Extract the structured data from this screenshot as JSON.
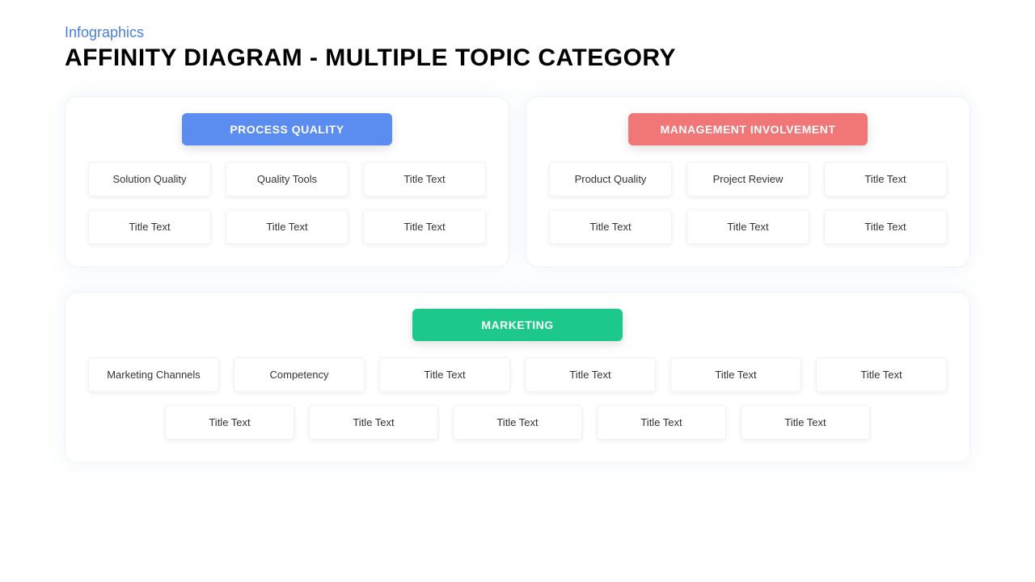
{
  "header": {
    "subtitle": "Infographics",
    "title": "AFFINITY DIAGRAM - MULTIPLE TOPIC CATEGORY"
  },
  "colors": {
    "blue": "#5b8cf0",
    "red": "#f07677",
    "green": "#1dc98a"
  },
  "categories": [
    {
      "id": "process-quality",
      "label": "PROCESS QUALITY",
      "color": "blue",
      "items": [
        "Solution Quality",
        "Quality Tools",
        "Title Text",
        "Title Text",
        "Title Text",
        "Title Text"
      ]
    },
    {
      "id": "management-involvement",
      "label": "MANAGEMENT INVOLVEMENT",
      "color": "red",
      "items": [
        "Product Quality",
        "Project Review",
        "Title Text",
        "Title Text",
        "Title Text",
        "Title Text"
      ]
    },
    {
      "id": "marketing",
      "label": "MARKETING",
      "color": "green",
      "row1": [
        "Marketing Channels",
        "Competency",
        "Title Text",
        "Title Text",
        "Title Text",
        "Title Text"
      ],
      "row2": [
        "Title Text",
        "Title Text",
        "Title Text",
        "Title Text",
        "Title Text"
      ]
    }
  ]
}
